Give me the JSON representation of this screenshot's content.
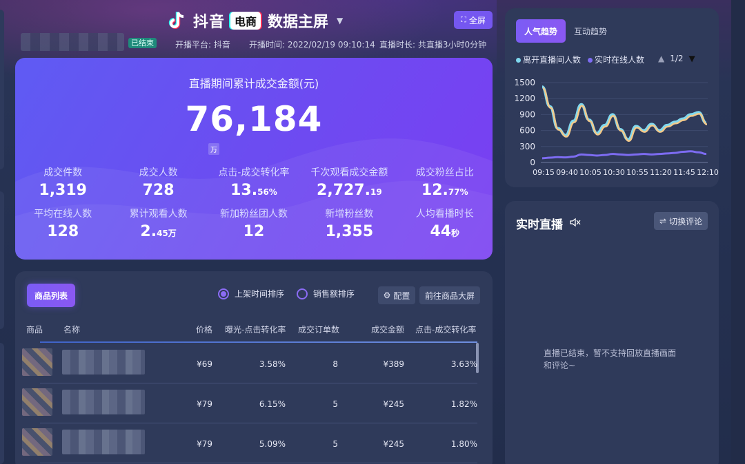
{
  "header": {
    "brand_text": "抖音",
    "brand_badge": "电商",
    "screen_title": "数据主屏",
    "fullscreen_label": "全屏"
  },
  "info": {
    "status": "已结束",
    "platform": "开播平台: 抖音",
    "start_time": "开播时间: 2022/02/19 09:10:14",
    "duration": "直播时长: 共直播3小时0分钟"
  },
  "summary": {
    "title": "直播期间累计成交金额(元)",
    "value": "76,184",
    "unit": "万",
    "metrics": [
      {
        "label": "成交件数",
        "value": "1,319",
        "suffix": ""
      },
      {
        "label": "成交人数",
        "value": "728",
        "suffix": ""
      },
      {
        "label": "点击-成交转化率",
        "value": "13.",
        "suffix": "56%"
      },
      {
        "label": "千次观看成交金额",
        "value": "2,727.",
        "suffix": "19"
      },
      {
        "label": "成交粉丝占比",
        "value": "12.",
        "suffix": "77%"
      },
      {
        "label": "平均在线人数",
        "value": "128",
        "suffix": ""
      },
      {
        "label": "累计观看人数",
        "value": "2.",
        "suffix": "45万"
      },
      {
        "label": "新加粉丝团人数",
        "value": "12",
        "suffix": ""
      },
      {
        "label": "新增粉丝数",
        "value": "1,355",
        "suffix": ""
      },
      {
        "label": "人均看播时长",
        "value": "44",
        "suffix": "秒"
      }
    ]
  },
  "products": {
    "tab_label": "商品列表",
    "sort_time": "上架时间排序",
    "sort_sales": "销售额排序",
    "config_label": "配置",
    "open_big_screen": "前往商品大屏",
    "columns": [
      "商品",
      "名称",
      "价格",
      "曝光-点击转化率",
      "成交订单数",
      "成交金额",
      "点击-成交转化率"
    ],
    "rows": [
      {
        "price": "¥69",
        "exposure_rate": "3.58%",
        "orders": "8",
        "amount": "¥389",
        "click_rate": "3.63%"
      },
      {
        "price": "¥79",
        "exposure_rate": "6.15%",
        "orders": "5",
        "amount": "¥245",
        "click_rate": "1.82%"
      },
      {
        "price": "¥79",
        "exposure_rate": "5.09%",
        "orders": "5",
        "amount": "¥245",
        "click_rate": "1.80%"
      }
    ]
  },
  "trend": {
    "tab_popularity": "人气趋势",
    "tab_interaction": "互动趋势",
    "legend_leave": "离开直播间人数",
    "legend_online": "实时在线人数",
    "pager": "1/2",
    "colors": {
      "leave": "#7fd8ef",
      "leave_overlay": "#f3c98a",
      "online": "#7d6cf2"
    }
  },
  "chart_data": {
    "type": "line",
    "x": [
      "09:15",
      "09:40",
      "10:05",
      "10:30",
      "10:55",
      "11:20",
      "11:45",
      "12:10"
    ],
    "ylim": [
      0,
      1500
    ],
    "yticks": [
      0,
      300,
      600,
      900,
      1200,
      1500
    ],
    "series": [
      {
        "name": "离开直播间人数",
        "values": [
          1420,
          1050,
          640,
          510,
          780,
          1090,
          800,
          550,
          700,
          900,
          620,
          430,
          680,
          600,
          720,
          600,
          700,
          760,
          820,
          900,
          940,
          740
        ]
      },
      {
        "name": "实时在线人数",
        "values": [
          80,
          90,
          100,
          95,
          110,
          150,
          140,
          130,
          140,
          160,
          150,
          140,
          150,
          160,
          150,
          160,
          170,
          180,
          200,
          210,
          190,
          160
        ]
      }
    ]
  },
  "live": {
    "title": "实时直播",
    "switch_label": "切换评论",
    "message": "直播已结束，暂不支持回放直播画面和评论~"
  }
}
